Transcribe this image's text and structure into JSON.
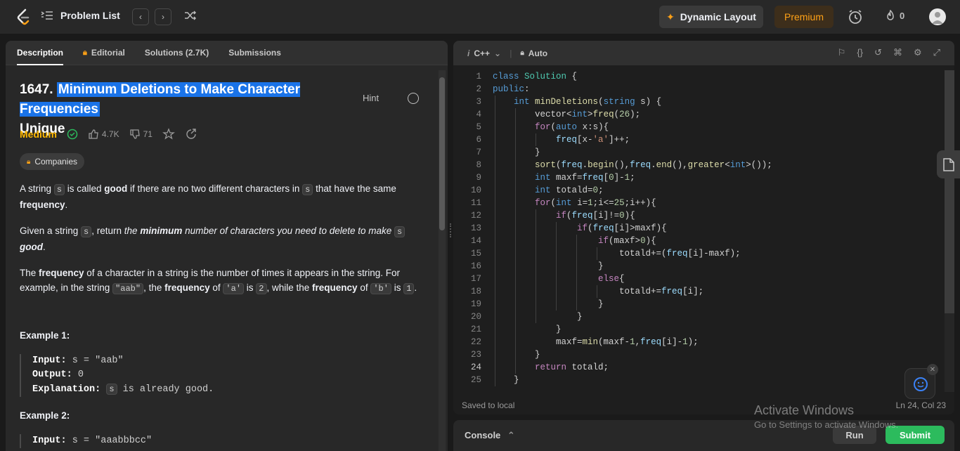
{
  "topbar": {
    "problem_list": "Problem List",
    "dynamic_layout": "Dynamic Layout",
    "premium": "Premium",
    "streak": "0"
  },
  "left_tabs": [
    {
      "label": "Description"
    },
    {
      "label": "Editorial"
    },
    {
      "label": "Solutions (2.7K)"
    },
    {
      "label": "Submissions"
    }
  ],
  "problem": {
    "number": "1647.",
    "title_highlighted": "Minimum Deletions to Make Character Frequencies",
    "title_rest": "Unique",
    "hint": "Hint",
    "difficulty": "Medium",
    "likes": "4.7K",
    "dislikes": "71",
    "companies": "Companies"
  },
  "description": {
    "p1_a": "A string ",
    "p1_code1": "s",
    "p1_b": " is called ",
    "p1_bold": "good",
    "p1_c": " if there are no two different characters in ",
    "p1_code2": "s",
    "p1_d": " that have the same ",
    "p1_bold2": "frequency",
    "p1_e": ".",
    "p2_a": "Given a string ",
    "p2_code": "s",
    "p2_b": ", return ",
    "p2_i1": "the ",
    "p2_bi": "minimum",
    "p2_i2": " number of characters you need to delete to make ",
    "p2_code2": "s",
    "p2_bi2": "good",
    "p2_c": ".",
    "p3_a": "The ",
    "p3_bold": "frequency",
    "p3_b": " of a character in a string is the number of times it appears in the string. For example, in the string ",
    "p3_code1": "\"aab\"",
    "p3_c": ", the ",
    "p3_bold2": "frequency",
    "p3_d": " of ",
    "p3_code2": "'a'",
    "p3_e": " is ",
    "p3_code3": "2",
    "p3_f": ", while the ",
    "p3_bold3": "frequency",
    "p3_g": " of ",
    "p3_code4": "'b'",
    "p3_h": " is ",
    "p3_code5": "1",
    "p3_i": "."
  },
  "examples": [
    {
      "title": "Example 1:",
      "input_label": "Input:",
      "input": "s = \"aab\"",
      "output_label": "Output:",
      "output": "0",
      "expl_label": "Explanation:",
      "expl_code": "s",
      "expl_text": " is already good."
    },
    {
      "title": "Example 2:",
      "input_label": "Input:",
      "input": "s = \"aaabbbcc\""
    }
  ],
  "editor": {
    "language": "C++",
    "mode": "Auto",
    "saved": "Saved to local",
    "cursor": "Ln 24, Col 23",
    "current_line": 24
  },
  "console": {
    "label": "Console",
    "run": "Run",
    "submit": "Submit"
  },
  "watermark": {
    "line1": "Activate Windows",
    "line2": "Go to Settings to activate Windows."
  },
  "colors": {
    "accent_green": "#2cbb5d",
    "medium": "#ffb800",
    "premium": "#ffa116",
    "highlight": "#1a73e8"
  }
}
